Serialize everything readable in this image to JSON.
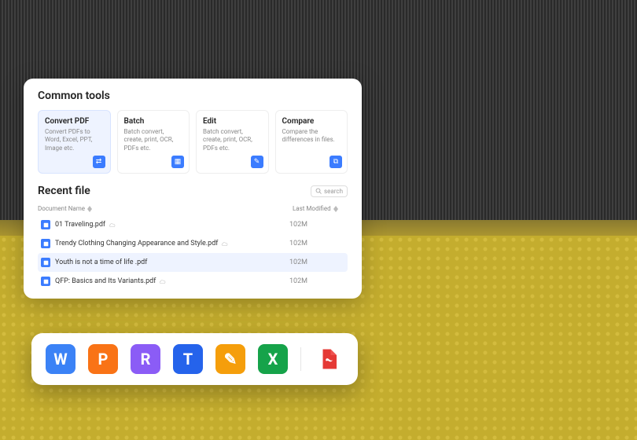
{
  "panel": {
    "tools_heading": "Common tools",
    "tools": [
      {
        "title": "Convert PDF",
        "desc": "Convert PDFs to Word, Excel, PPT, Image etc.",
        "icon_bg": "#3b7cff",
        "active": true
      },
      {
        "title": "Batch",
        "desc": "Batch convert, create, print, OCR, PDFs etc.",
        "icon_bg": "#3b7cff",
        "active": false
      },
      {
        "title": "Edit",
        "desc": "Batch convert, create, print, OCR, PDFs etc.",
        "icon_bg": "#3b7cff",
        "active": false
      },
      {
        "title": "Compare",
        "desc": "Compare the differences in files.",
        "icon_bg": "#3b7cff",
        "active": false
      }
    ],
    "recent_heading": "Recent file",
    "search_placeholder": "search",
    "columns": {
      "name": "Document Name",
      "modified": "Last Modified"
    },
    "rows": [
      {
        "name": "01 Traveling.pdf",
        "modified": "102M",
        "cloud": true,
        "hl": false
      },
      {
        "name": "Trendy Clothing Changing Appearance and Style.pdf",
        "modified": "102M",
        "cloud": true,
        "hl": false
      },
      {
        "name": "Youth is not a time of life .pdf",
        "modified": "102M",
        "cloud": false,
        "hl": true
      },
      {
        "name": "QFP: Basics and Its Variants.pdf",
        "modified": "102M",
        "cloud": true,
        "hl": false
      }
    ]
  },
  "strip": {
    "apps": [
      {
        "letter": "W",
        "bg": "#3b82f6"
      },
      {
        "letter": "P",
        "bg": "#f97316"
      },
      {
        "letter": "R",
        "bg": "#8b5cf6"
      },
      {
        "letter": "T",
        "bg": "#2563eb"
      },
      {
        "letter": "✎",
        "bg": "#f59e0b"
      },
      {
        "letter": "X",
        "bg": "#16a34a"
      }
    ]
  }
}
